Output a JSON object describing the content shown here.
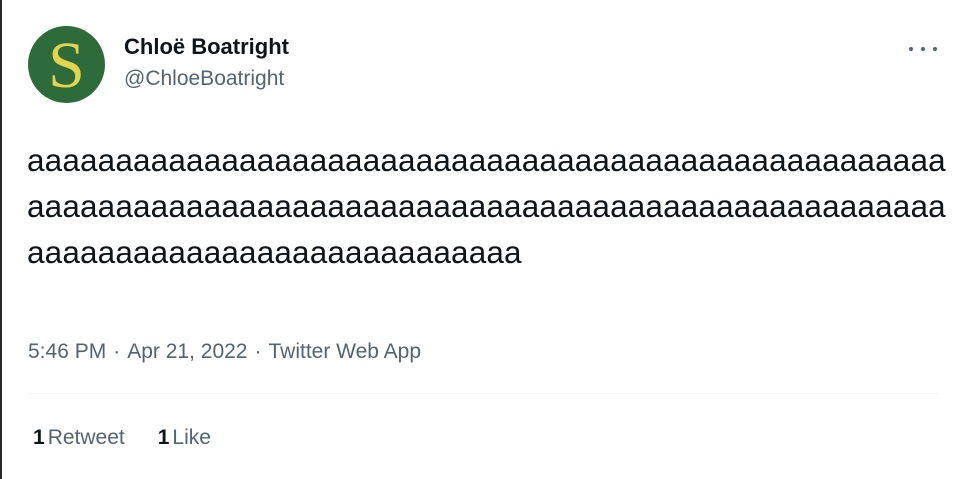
{
  "user": {
    "display_name": "Chloë Boatright",
    "handle": "@ChloeBoatright",
    "avatar_letter": "S",
    "avatar_bg": "#2d6b3a",
    "avatar_fg": "#e3d44e"
  },
  "tweet": {
    "text": "aaaaaaaaaaaaaaaaaaaaaaaaaaaaaaaaaaaaaaaaaaaaaaaaaaaaaaaaaaaaaaaaaaaaaaaaaaaaaaaaaaaaaaaaaaaaaaaaaaaaaaaaaaaaaaaaaaaaaaaaaaaaaaaaaaaa",
    "time": "5:46 PM",
    "date": "Apr 21, 2022",
    "source": "Twitter Web App",
    "separator": "·"
  },
  "stats": {
    "retweets_count": "1",
    "retweets_label": "Retweet",
    "likes_count": "1",
    "likes_label": "Like"
  },
  "icons": {
    "more": "more-options-icon"
  }
}
